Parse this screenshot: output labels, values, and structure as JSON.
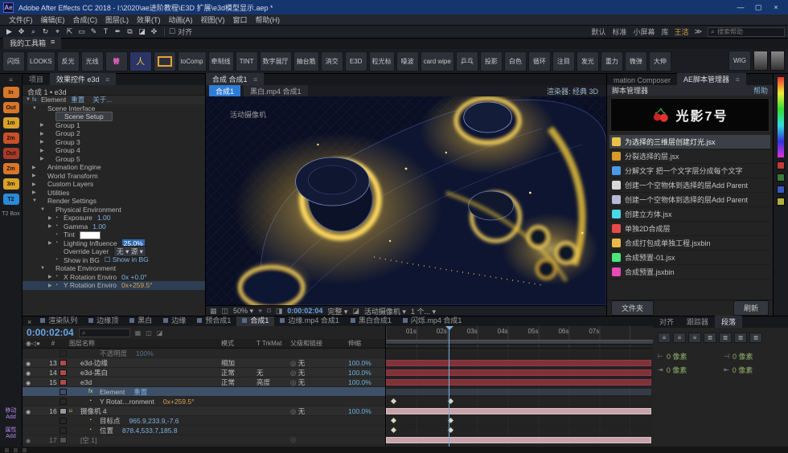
{
  "icons": {
    "menu": "≡",
    "close": "×",
    "min": "—",
    "max": "▢",
    "search": "⌕",
    "overflow": "≫",
    "chev": "▾",
    "eye": "◉",
    "audio": "◁",
    "solo": "●",
    "hash": "#",
    "grid": "▦",
    "mask": "◫",
    "safe": "⌖",
    "snapshot": "⌑",
    "channel": "◨",
    "pixelar": "◪",
    "checkbox": "☐"
  },
  "titlebar": {
    "logo": "Ae",
    "title": "Adobe After Effects CC 2018 - I:\\2020\\ae进阶教程\\E3D 扩展\\e3d模型显示.aep *"
  },
  "menubar": [
    "文件(F)",
    "编辑(E)",
    "合成(C)",
    "图层(L)",
    "效果(T)",
    "动画(A)",
    "视图(V)",
    "窗口",
    "帮助(H)"
  ],
  "toolbar": {
    "tools": [
      "▶",
      "✥",
      "⌕",
      "↻",
      "⌖",
      "⇱",
      "▭",
      "✎",
      "T",
      "✒",
      "⧉",
      "◪",
      "✜"
    ],
    "align_label": "对齐",
    "workspaces": [
      "默认",
      "标准",
      "小屏幕",
      "库"
    ],
    "user": "王洁",
    "search_placeholder": "搜索帮助"
  },
  "toolbox": {
    "tab": "我的工具箱",
    "buttons": [
      {
        "label": "闪烁",
        "cls": ""
      },
      {
        "label": "LOOKS",
        "cls": ""
      },
      {
        "label": "反光",
        "cls": ""
      },
      {
        "label": "光线",
        "cls": ""
      },
      {
        "label": "替",
        "cls": "ti"
      },
      {
        "label": "",
        "cls": "person"
      },
      {
        "label": "",
        "cls": "rect"
      },
      {
        "label": "toComp",
        "cls": ""
      },
      {
        "label": "牵制线",
        "cls": ""
      },
      {
        "label": "TINT",
        "cls": ""
      },
      {
        "label": "数字展厅",
        "cls": ""
      },
      {
        "label": "抽台筋",
        "cls": ""
      },
      {
        "label": "消交",
        "cls": ""
      },
      {
        "label": "E3D",
        "cls": ""
      },
      {
        "label": "粒光标",
        "cls": ""
      },
      {
        "label": "噪波",
        "cls": ""
      },
      {
        "label": "card wipe",
        "cls": ""
      },
      {
        "label": "乒乓",
        "cls": ""
      },
      {
        "label": "投影",
        "cls": ""
      },
      {
        "label": "白色",
        "cls": ""
      },
      {
        "label": "循环",
        "cls": ""
      },
      {
        "label": "注目",
        "cls": ""
      },
      {
        "label": "发光",
        "cls": ""
      },
      {
        "label": "重力",
        "cls": ""
      },
      {
        "label": "微弹",
        "cls": ""
      },
      {
        "label": "大伸",
        "cls": ""
      }
    ],
    "wig": "WIG"
  },
  "strip": {
    "items": [
      {
        "label": "In",
        "color": "#d8762a"
      },
      {
        "label": "Out",
        "color": "#d8762a"
      },
      {
        "label": "1m",
        "color": "#d8a22a"
      },
      {
        "label": "2m",
        "color": "#c8502a"
      },
      {
        "label": "Out",
        "color": "#a83a2a"
      },
      {
        "label": "Zm",
        "color": "#d8762a"
      },
      {
        "label": "3m",
        "color": "#d8a22a"
      },
      {
        "label": "T2",
        "color": "#2a8ad8"
      }
    ],
    "box_label": "T2 Box",
    "bottom": [
      {
        "label": "移动",
        "sub": "Add"
      },
      {
        "label": "属性",
        "sub": "Add"
      }
    ]
  },
  "effects": {
    "tab_project": "项目",
    "tab_active": "效果控件 e3d",
    "subtitle": "合成 1 • e3d",
    "rows": [
      {
        "cls": "lv0 fxroot",
        "tw": "▼",
        "pre": "fx",
        "label": "Element",
        "val": "重置",
        "val2": "关于..."
      },
      {
        "cls": "lv1",
        "tw": "▼",
        "label": "Scene Interface"
      },
      {
        "cls": "lv2 btnrow",
        "label": "Scene Setup"
      },
      {
        "cls": "lv2",
        "tw": "▶",
        "label": "Group 1"
      },
      {
        "cls": "lv2",
        "tw": "▶",
        "label": "Group 2"
      },
      {
        "cls": "lv2",
        "tw": "▶",
        "label": "Group 3"
      },
      {
        "cls": "lv2",
        "tw": "▶",
        "label": "Group 4"
      },
      {
        "cls": "lv2",
        "tw": "▶",
        "label": "Group 5"
      },
      {
        "cls": "lv1",
        "tw": "▶",
        "label": "Animation Engine"
      },
      {
        "cls": "lv1",
        "tw": "▶",
        "label": "World Transform"
      },
      {
        "cls": "lv1",
        "tw": "▶",
        "label": "Custom Layers"
      },
      {
        "cls": "lv1",
        "tw": "▶",
        "label": "Utilities"
      },
      {
        "cls": "lv1",
        "tw": "▼",
        "label": "Render Settings"
      },
      {
        "cls": "lv2",
        "tw": "▼",
        "label": "Physical Environment"
      },
      {
        "cls": "lv3",
        "tw": "▶",
        "pre": "◔",
        "label": "Exposure",
        "val": "1.00"
      },
      {
        "cls": "lv3",
        "tw": "▶",
        "pre": "◔",
        "label": "Gamma",
        "val": "1.00"
      },
      {
        "cls": "lv3 swatch",
        "pre": "◔",
        "label": "Tint"
      },
      {
        "cls": "lv3 editing",
        "tw": "▶",
        "pre": "◔",
        "label": "Lighting Influence",
        "val": "25.0%"
      },
      {
        "cls": "lv3 dd",
        "label": "Override Layer",
        "val": "无 ▾   源 ▾"
      },
      {
        "cls": "lv3",
        "pre": "◔",
        "label": "Show in BG",
        "val": "☐ Show in BG"
      },
      {
        "cls": "lv2",
        "tw": "▼",
        "label": "Rotate Environment"
      },
      {
        "cls": "lv3",
        "tw": "▶",
        "pre": "◔",
        "label": "X Rotation Enviro",
        "val": "0x +0.0°"
      },
      {
        "cls": "lv3 hl",
        "tw": "▶",
        "pre": "◔",
        "label": "Y Rotation Enviro",
        "val": "0x+259.5°"
      }
    ]
  },
  "viewer": {
    "panel_tab": "合成 合成1",
    "comp_tabs": [
      {
        "label": "合成1",
        "cls": "active"
      },
      {
        "label": "黑白.mp4 合成1",
        "cls": ""
      }
    ],
    "renderer": "渲染器: 经典 3D",
    "camera_label": "活动摄像机",
    "status": {
      "zoom": "50%",
      "timecode": "0:00:02:04",
      "res": "完整",
      "cam": "活动摄像机",
      "views": "1 个..."
    }
  },
  "scripts": {
    "tab_left": "mation Composer",
    "tab_active": "AE脚本管理器",
    "title": "脚本管理器",
    "help": "帮助",
    "brand": "光影7号",
    "items": [
      {
        "color": "#e8c34a",
        "label": "为选择的三维层创建灯光.jsx",
        "cls": "sel"
      },
      {
        "color": "#d89a2a",
        "label": "分裂选择的层.jsx",
        "cls": ""
      },
      {
        "color": "#4a9ae8",
        "label": "分解文字 把一个文字层分成每个文字",
        "cls": ""
      },
      {
        "color": "#d8d8d8",
        "label": "创建一个空物体到选择的层Add Parent",
        "cls": ""
      },
      {
        "color": "#b8b8d8",
        "label": "创建一个空物体到选择的层Add Parent",
        "cls": ""
      },
      {
        "color": "#4ad8e8",
        "label": "创建立方体.jsx",
        "cls": ""
      },
      {
        "color": "#e84a4a",
        "label": "单独2D合成层",
        "cls": ""
      },
      {
        "color": "#e8b84a",
        "label": "合成打包成单独工程.jsxbin",
        "cls": ""
      },
      {
        "color": "#4ae87a",
        "label": "合成预置-01.jsx",
        "cls": ""
      },
      {
        "color": "#e84ab8",
        "label": "合成预置.jsxbin",
        "cls": ""
      }
    ],
    "folder": "文件夹",
    "refresh": "刷新"
  },
  "bottom_tabs": {
    "items": [
      {
        "label": "渲染队列",
        "cls": ""
      },
      {
        "label": "边缘顶",
        "cls": ""
      },
      {
        "label": "黑白",
        "cls": ""
      },
      {
        "label": "边缘",
        "cls": ""
      },
      {
        "label": "预合成1",
        "cls": ""
      },
      {
        "label": "合成1",
        "cls": "active"
      },
      {
        "label": "边缘.mp4 合成1",
        "cls": ""
      },
      {
        "label": "黑白合成1",
        "cls": ""
      },
      {
        "label": "闪烁.mp4 合成1",
        "cls": ""
      }
    ]
  },
  "timeline": {
    "timecode": "0:00:02:04",
    "search_placeholder": "",
    "cols": {
      "num": "#",
      "name": "图层名称",
      "mode": "模式",
      "trkmat": "T TrkMat",
      "parent": "父级和链接",
      "stretch": "伸缩"
    },
    "ruler": [
      "01s",
      "02s",
      "03s",
      "04s",
      "05s",
      "06s",
      "07s"
    ],
    "rows": [
      {
        "cls": "prop dim",
        "pre": "",
        "name": "不透明度",
        "val": "100%",
        "valcls": "",
        "bar": "",
        "kfs": []
      },
      {
        "cls": "layer",
        "eye": "◉",
        "num": "13",
        "color": "#b04a4a",
        "name": "e3d-边缘",
        "mode": "相加",
        "trkmat": "",
        "parent": "无",
        "stretch": "100.0%",
        "bar": "red",
        "kfs": []
      },
      {
        "cls": "layer",
        "eye": "◉",
        "num": "14",
        "color": "#b04a4a",
        "name": "e3d-黑白",
        "mode": "正常",
        "trkmat": "无",
        "parent": "无",
        "stretch": "100.0%",
        "bar": "red",
        "kfs": []
      },
      {
        "cls": "layer",
        "eye": "◉",
        "num": "15",
        "color": "#b04a4a",
        "name": "e3d",
        "mode": "正常",
        "trkmat": "亮度",
        "parent": "无",
        "stretch": "100.0%",
        "bar": "red",
        "kfs": []
      },
      {
        "cls": "prop sel",
        "pre": "fx",
        "name": "Element",
        "val": "重置",
        "valcls": "",
        "bar": "sel",
        "kfs": []
      },
      {
        "cls": "prop",
        "pre": "◔",
        "name": "Y Rotat…ronment",
        "val": "0x+259.5°",
        "valcls": "orange",
        "bar": "",
        "kfs": [
          2,
          23.5
        ]
      },
      {
        "cls": "layer cam",
        "eye": "◉",
        "num": "16",
        "color": "#9a9a9a",
        "pre": "⌑",
        "name": "摄像机 4",
        "mode": "",
        "trkmat": "",
        "parent": "无",
        "stretch": "100.0%",
        "bar": "pink",
        "kfs": []
      },
      {
        "cls": "prop",
        "pre": "◔",
        "name": "目标点",
        "val": "965.9,233.9,-7.6",
        "valcls": "",
        "bar": "",
        "kfs": [
          2,
          23.5
        ]
      },
      {
        "cls": "prop",
        "pre": "◔",
        "name": "位置",
        "val": "878.4,533.7,185.8",
        "valcls": "",
        "bar": "",
        "kfs": [
          2,
          23.5
        ]
      },
      {
        "cls": "layer dim",
        "eye": "◉",
        "num": "17",
        "color": "#777777",
        "name": "[空 1]",
        "mode": "",
        "trkmat": "",
        "parent": "",
        "stretch": "",
        "bar": "pink",
        "kfs": []
      }
    ]
  },
  "para": {
    "tabs": [
      {
        "label": "对齐",
        "cls": ""
      },
      {
        "label": "跟踪器",
        "cls": ""
      },
      {
        "label": "段落",
        "cls": "active"
      }
    ],
    "fields": [
      {
        "icon": "⊢",
        "val": "0 像素"
      },
      {
        "icon": "⊣",
        "val": "0 像素"
      },
      {
        "icon": "⇥",
        "val": "0 像素"
      },
      {
        "icon": "⇤",
        "val": "0 像素"
      }
    ]
  }
}
